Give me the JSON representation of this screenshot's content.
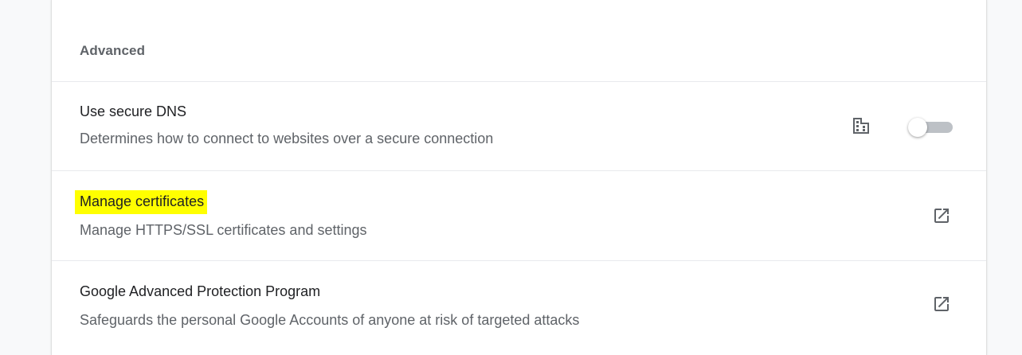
{
  "section": {
    "header": "Advanced"
  },
  "rows": [
    {
      "title": "Use secure DNS",
      "subtitle": "Determines how to connect to websites over a secure connection",
      "control": "toggle",
      "toggle_on": false,
      "policy_icon": "enterprise-policy-icon"
    },
    {
      "title": "Manage certificates",
      "subtitle": "Manage HTTPS/SSL certificates and settings",
      "control": "external-link-icon",
      "highlight_color": "#ffff00"
    },
    {
      "title": "Google Advanced Protection Program",
      "subtitle": "Safeguards the personal Google Accounts of anyone at risk of targeted attacks",
      "control": "external-link-icon"
    }
  ],
  "colors": {
    "title_text": "#202124",
    "secondary_text": "#5f6368",
    "toggle_track_off": "#bdc1c6",
    "divider": "#e8eaed",
    "page_background": "#f8f9fa"
  }
}
